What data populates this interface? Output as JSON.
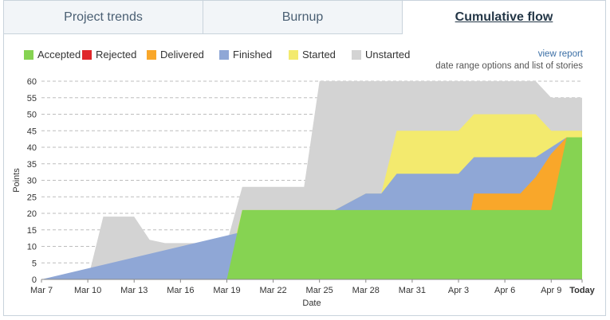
{
  "tabs": [
    {
      "label": "Project trends",
      "active": false
    },
    {
      "label": "Burnup",
      "active": false
    },
    {
      "label": "Cumulative flow",
      "active": true
    }
  ],
  "links": {
    "view_report": "view report",
    "range_options": "date range options and list of stories"
  },
  "chart_data": {
    "type": "area",
    "stacked": true,
    "xlabel": "Date",
    "ylabel": "Points",
    "ylim": [
      0,
      60
    ],
    "ytick_step": 5,
    "grid": "horizontal dashed",
    "legend_placement": "top-left",
    "x_tick_labels": [
      "Mar 7",
      "Mar 10",
      "Mar 13",
      "Mar 16",
      "Mar 19",
      "Mar 22",
      "Mar 25",
      "Mar 28",
      "Mar 31",
      "Apr 3",
      "Apr 6",
      "Apr 9",
      "Today"
    ],
    "x_tick_dates": [
      "2014-03-07",
      "2014-03-10",
      "2014-03-13",
      "2014-03-16",
      "2014-03-19",
      "2014-03-22",
      "2014-03-25",
      "2014-03-28",
      "2014-03-31",
      "2014-04-03",
      "2014-04-06",
      "2014-04-09",
      "2014-04-11"
    ],
    "xlim": [
      "2014-03-07",
      "2014-04-11"
    ],
    "series": [
      {
        "name": "Accepted",
        "color": "#86d352",
        "points": [
          [
            "2014-03-07",
            0
          ],
          [
            "2014-03-19",
            0
          ],
          [
            "2014-03-20",
            21
          ],
          [
            "2014-04-09",
            21
          ],
          [
            "2014-04-10",
            43
          ],
          [
            "2014-04-11",
            43
          ]
        ]
      },
      {
        "name": "Rejected",
        "color": "#e0262a",
        "points": [
          [
            "2014-03-07",
            0
          ],
          [
            "2014-04-11",
            0
          ]
        ]
      },
      {
        "name": "Delivered",
        "color": "#f9a72a",
        "points": [
          [
            "2014-03-07",
            0
          ],
          [
            "2014-04-03",
            0
          ],
          [
            "2014-04-04",
            26
          ],
          [
            "2014-04-07",
            26
          ],
          [
            "2014-04-08",
            31
          ],
          [
            "2014-04-09",
            38
          ],
          [
            "2014-04-10",
            43
          ],
          [
            "2014-04-11",
            43
          ]
        ]
      },
      {
        "name": "Finished",
        "color": "#8fa7d6",
        "points": [
          [
            "2014-03-07",
            0
          ],
          [
            "2014-03-26",
            21
          ],
          [
            "2014-03-28",
            26
          ],
          [
            "2014-03-29",
            26
          ],
          [
            "2014-03-30",
            32
          ],
          [
            "2014-04-03",
            32
          ],
          [
            "2014-04-04",
            37
          ],
          [
            "2014-04-07",
            37
          ],
          [
            "2014-04-08",
            37
          ],
          [
            "2014-04-09",
            40
          ],
          [
            "2014-04-10",
            43
          ],
          [
            "2014-04-11",
            43
          ]
        ]
      },
      {
        "name": "Started",
        "color": "#f3ea6e",
        "points": [
          [
            "2014-03-07",
            0
          ],
          [
            "2014-03-11",
            0
          ],
          [
            "2014-03-12",
            3
          ],
          [
            "2014-03-13",
            3
          ],
          [
            "2014-03-14",
            3
          ],
          [
            "2014-03-15",
            2
          ],
          [
            "2014-03-19",
            2
          ],
          [
            "2014-03-20",
            21
          ],
          [
            "2014-03-26",
            21
          ],
          [
            "2014-03-28",
            26
          ],
          [
            "2014-03-29",
            26
          ],
          [
            "2014-03-30",
            45
          ],
          [
            "2014-04-03",
            45
          ],
          [
            "2014-04-04",
            50
          ],
          [
            "2014-04-07",
            50
          ],
          [
            "2014-04-08",
            50
          ],
          [
            "2014-04-09",
            45
          ],
          [
            "2014-04-10",
            45
          ],
          [
            "2014-04-11",
            45
          ]
        ]
      },
      {
        "name": "Unstarted",
        "color": "#d3d3d3",
        "points": [
          [
            "2014-03-07",
            0
          ],
          [
            "2014-03-10",
            0
          ],
          [
            "2014-03-11",
            19
          ],
          [
            "2014-03-13",
            19
          ],
          [
            "2014-03-14",
            12
          ],
          [
            "2014-03-15",
            11
          ],
          [
            "2014-03-19",
            11
          ],
          [
            "2014-03-20",
            28
          ],
          [
            "2014-03-24",
            28
          ],
          [
            "2014-03-25",
            60
          ],
          [
            "2014-04-08",
            60
          ],
          [
            "2014-04-09",
            55
          ],
          [
            "2014-04-11",
            55
          ]
        ]
      }
    ]
  }
}
